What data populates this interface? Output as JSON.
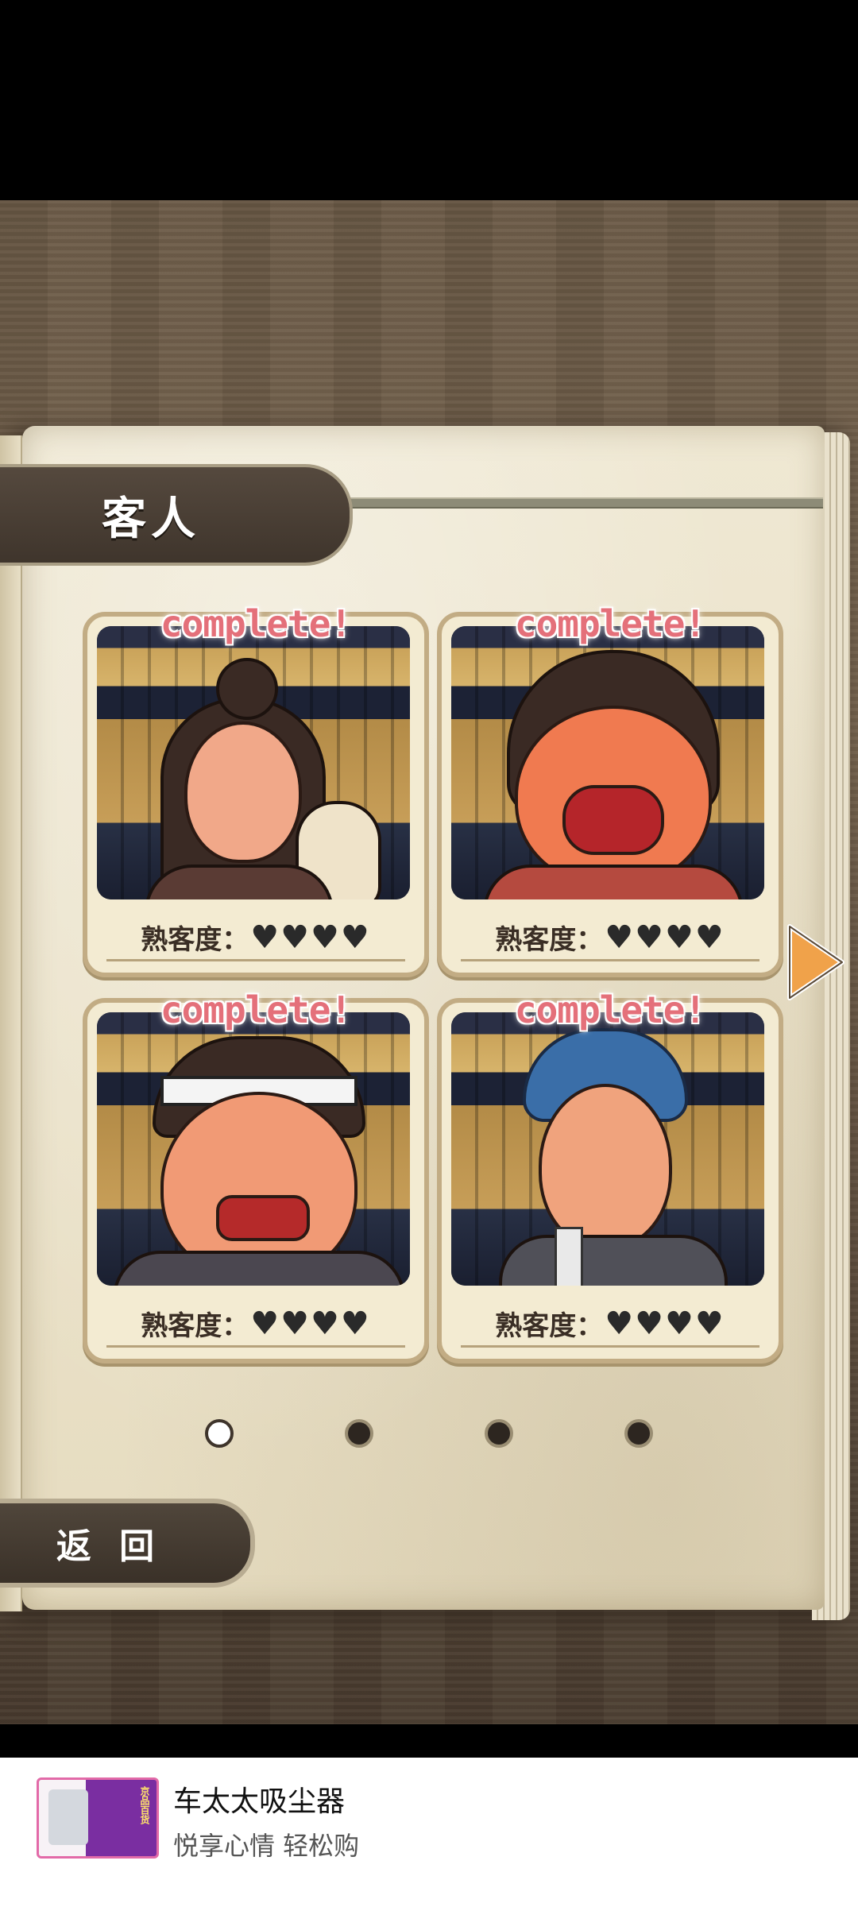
{
  "screen": {
    "section_title": "客人",
    "back_label": "返 回",
    "next_page_icon": "triangle-right-icon",
    "pager": {
      "total": 4,
      "active_index": 0
    }
  },
  "customers": [
    {
      "status": "complete!",
      "familiarity_label": "熟客度：",
      "hearts": "♥♥♥♥",
      "hearts_filled": 4,
      "hearts_max": 4
    },
    {
      "status": "complete!",
      "familiarity_label": "熟客度：",
      "hearts": "♥♥♥♥",
      "hearts_filled": 4,
      "hearts_max": 4
    },
    {
      "status": "complete!",
      "familiarity_label": "熟客度：",
      "hearts": "♥♥♥♥",
      "hearts_filled": 4,
      "hearts_max": 4
    },
    {
      "status": "complete!",
      "familiarity_label": "熟客度：",
      "hearts": "♥♥♥♥",
      "hearts_filled": 4,
      "hearts_max": 4
    }
  ],
  "ad": {
    "title": "车太太吸尘器",
    "subtitle": "悦享心情 轻松购",
    "thumb_badge": "京品百货"
  },
  "colors": {
    "accent_arrow": "#f0a24a",
    "complete_text": "#e4707a",
    "tab_bg": "#4a3f35"
  }
}
